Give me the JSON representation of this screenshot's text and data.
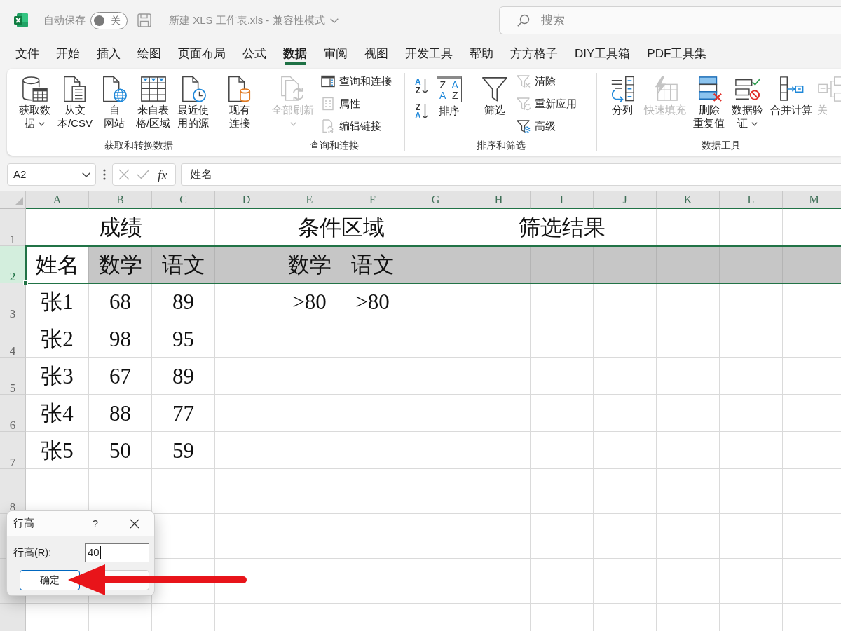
{
  "title_bar": {
    "autosave_label": "自动保存",
    "autosave": {
      "on": false,
      "label": "关"
    },
    "document_title": "新建 XLS 工作表.xls - 兼容性模式",
    "search": {
      "placeholder": "搜索"
    }
  },
  "menu_tabs": [
    {
      "label": "文件",
      "selected": false
    },
    {
      "label": "开始",
      "selected": false
    },
    {
      "label": "插入",
      "selected": false
    },
    {
      "label": "绘图",
      "selected": false
    },
    {
      "label": "页面布局",
      "selected": false
    },
    {
      "label": "公式",
      "selected": false
    },
    {
      "label": "数据",
      "selected": true
    },
    {
      "label": "审阅",
      "selected": false
    },
    {
      "label": "视图",
      "selected": false
    },
    {
      "label": "开发工具",
      "selected": false
    },
    {
      "label": "帮助",
      "selected": false
    },
    {
      "label": "方方格子",
      "selected": false
    },
    {
      "label": "DIY工具箱",
      "selected": false
    },
    {
      "label": "PDF工具集",
      "selected": false
    }
  ],
  "ribbon": {
    "groups": [
      {
        "label": "获取和转换数据",
        "items": [
          {
            "kind": "large",
            "lines": [
              "获取数",
              "据"
            ],
            "dropdown": true,
            "disabled": false
          },
          {
            "kind": "large",
            "lines": [
              "从文",
              "本/CSV"
            ],
            "dropdown": false,
            "disabled": false
          },
          {
            "kind": "large",
            "lines": [
              "自",
              "网站"
            ],
            "dropdown": false,
            "disabled": false
          },
          {
            "kind": "large",
            "lines": [
              "来自表",
              "格/区域"
            ],
            "dropdown": false,
            "disabled": false
          },
          {
            "kind": "large",
            "lines": [
              "最近使",
              "用的源"
            ],
            "dropdown": false,
            "disabled": false
          },
          {
            "kind": "separator"
          },
          {
            "kind": "large",
            "lines": [
              "现有",
              "连接"
            ],
            "dropdown": false,
            "disabled": false
          }
        ]
      },
      {
        "label": "查询和连接",
        "items": [
          {
            "kind": "large",
            "lines": [
              "全部刷新"
            ],
            "dropdown": true,
            "disabled": true
          },
          {
            "kind": "stack",
            "items": [
              {
                "label": "查询和连接",
                "disabled": false
              },
              {
                "label": "属性",
                "disabled": true
              },
              {
                "label": "编辑链接",
                "disabled": true
              }
            ]
          }
        ]
      },
      {
        "label": "排序和筛选",
        "items": [
          {
            "kind": "sort_stack",
            "items": [
              {
                "letters": [
                  {
                    "text": "A",
                    "accent": true
                  },
                  {
                    "text": "Z",
                    "accent": false
                  }
                ]
              },
              {
                "letters": [
                  {
                    "text": "Z",
                    "accent": false
                  },
                  {
                    "text": "A",
                    "accent": true
                  }
                ]
              }
            ]
          },
          {
            "kind": "large",
            "lines": [
              "排序"
            ],
            "icon_letters": [
              {
                "text": "Z",
                "accent": false
              },
              {
                "text": "A",
                "accent": true
              },
              {
                "text": "A",
                "accent": true
              },
              {
                "text": "Z",
                "accent": false
              }
            ],
            "dropdown": false,
            "disabled": false
          },
          {
            "kind": "separator"
          },
          {
            "kind": "large",
            "lines": [
              "筛选"
            ],
            "dropdown": false,
            "disabled": false
          },
          {
            "kind": "stack",
            "items": [
              {
                "label": "清除",
                "disabled": true
              },
              {
                "label": "重新应用",
                "disabled": true
              },
              {
                "label": "高级",
                "disabled": false
              }
            ]
          }
        ]
      },
      {
        "label": "数据工具",
        "items": [
          {
            "kind": "large",
            "lines": [
              "分列"
            ],
            "dropdown": false,
            "disabled": false
          },
          {
            "kind": "large",
            "lines": [
              "快速填充"
            ],
            "dropdown": false,
            "disabled": true
          },
          {
            "kind": "large",
            "lines": [
              "删除",
              "重复值"
            ],
            "dropdown": false,
            "disabled": false
          },
          {
            "kind": "large",
            "lines": [
              "数据验",
              "证"
            ],
            "dropdown": true,
            "disabled": false
          },
          {
            "kind": "large",
            "lines": [
              "合并计算"
            ],
            "dropdown": false,
            "disabled": false
          },
          {
            "kind": "large",
            "lines": [
              "关"
            ],
            "dropdown": false,
            "disabled": true
          }
        ]
      }
    ]
  },
  "formula_bar": {
    "name_box": "A2",
    "function_label": "fx",
    "formula": "姓名"
  },
  "sheet": {
    "columns": [
      "A",
      "B",
      "C",
      "D",
      "E",
      "F",
      "G",
      "H",
      "I",
      "J",
      "K",
      "L",
      "M"
    ],
    "rows": [
      {
        "header": "1",
        "selected": false,
        "cells": [
          {
            "kind": "text",
            "text": "成绩",
            "active": false
          },
          {
            "kind": "merged"
          },
          {
            "kind": "merged"
          },
          {
            "kind": "empty"
          },
          {
            "kind": "text",
            "text": "条件区域",
            "active": false
          },
          {
            "kind": "merged"
          },
          {
            "kind": "empty"
          },
          {
            "kind": "text",
            "text": "筛选结果",
            "active": false
          },
          {
            "kind": "merged"
          },
          {
            "kind": "merged"
          }
        ]
      },
      {
        "header": "2",
        "selected": true,
        "cells": [
          {
            "kind": "text",
            "text": "姓名",
            "active": true
          },
          {
            "kind": "text",
            "text": "数学",
            "active": false
          },
          {
            "kind": "text",
            "text": "语文",
            "active": false
          },
          {
            "kind": "empty"
          },
          {
            "kind": "text",
            "text": "数学",
            "active": false
          },
          {
            "kind": "text",
            "text": "语文",
            "active": false
          }
        ]
      },
      {
        "header": "3",
        "selected": false,
        "cells": [
          {
            "kind": "text",
            "text": "张1",
            "active": false
          },
          {
            "kind": "text",
            "text": "68",
            "active": false
          },
          {
            "kind": "text",
            "text": "89",
            "active": false
          },
          {
            "kind": "empty"
          },
          {
            "kind": "text",
            "text": ">80",
            "active": false
          },
          {
            "kind": "text",
            "text": ">80",
            "active": false
          }
        ]
      },
      {
        "header": "4",
        "selected": false,
        "cells": [
          {
            "kind": "text",
            "text": "张2",
            "active": false
          },
          {
            "kind": "text",
            "text": "98",
            "active": false
          },
          {
            "kind": "text",
            "text": "95",
            "active": false
          }
        ]
      },
      {
        "header": "5",
        "selected": false,
        "cells": [
          {
            "kind": "text",
            "text": "张3",
            "active": false
          },
          {
            "kind": "text",
            "text": "67",
            "active": false
          },
          {
            "kind": "text",
            "text": "89",
            "active": false
          }
        ]
      },
      {
        "header": "6",
        "selected": false,
        "cells": [
          {
            "kind": "text",
            "text": "张4",
            "active": false
          },
          {
            "kind": "text",
            "text": "88",
            "active": false
          },
          {
            "kind": "text",
            "text": "77",
            "active": false
          }
        ]
      },
      {
        "header": "7",
        "selected": false,
        "cells": [
          {
            "kind": "text",
            "text": "张5",
            "active": false
          },
          {
            "kind": "text",
            "text": "50",
            "active": false
          },
          {
            "kind": "text",
            "text": "59",
            "active": false
          }
        ]
      },
      {
        "header": "8",
        "selected": false
      },
      {
        "selected": false
      },
      {
        "selected": false
      },
      {
        "selected": false
      }
    ]
  },
  "dialog": {
    "title": "行高",
    "help": "?",
    "label_parts": [
      {
        "text": "行高(",
        "underlined": false
      },
      {
        "text": "R",
        "underlined": true
      },
      {
        "text": "):",
        "underlined": false
      }
    ],
    "field": {
      "value": "40",
      "focused": true
    },
    "buttons": [
      {
        "label": "确定",
        "default": true
      },
      {
        "default": false
      }
    ]
  }
}
